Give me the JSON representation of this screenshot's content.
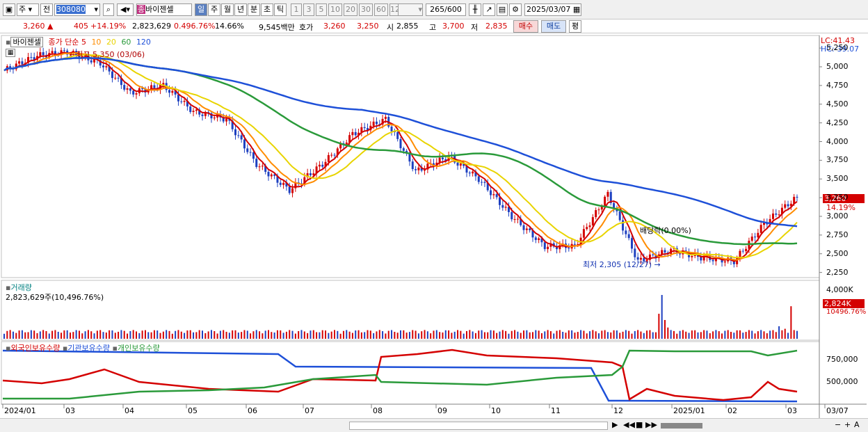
{
  "toolbar": {
    "period_type": "주",
    "prev_label": "전",
    "code": "308080",
    "name": "바이젠셀",
    "name_badge": "종",
    "tabs": [
      "일",
      "주",
      "월",
      "년",
      "분",
      "초",
      "틱"
    ],
    "active_tab": "일",
    "minute_opts": [
      "1",
      "3",
      "5",
      "10",
      "20",
      "30",
      "60",
      "120"
    ],
    "count": "265",
    "count_max": "/600",
    "date": "2025/03/07"
  },
  "quote": {
    "price": "3,260",
    "change": "405",
    "change_pct": "+14.19%",
    "volume": "2,823,629",
    "vol_ratio": "0.496.76%",
    "turnover": "14.66%",
    "amount": "9,545백만",
    "bid_label": "호가",
    "ask": "3,260",
    "bid": "3,250",
    "open_label": "시",
    "open": "2,855",
    "high_label": "고",
    "high": "3,700",
    "low_label": "저",
    "low": "2,835",
    "buy_label": "매수",
    "sell_label": "매도",
    "eval_label": "평"
  },
  "price_panel": {
    "title": "바이젠셀",
    "ma_label": "종가 단순",
    "ma_periods": [
      "5",
      "10",
      "20",
      "60",
      "120"
    ],
    "ma_colors": [
      "#d40000",
      "#ff8c00",
      "#e8d400",
      "#2a9a3a",
      "#1e50d8"
    ],
    "lc": "LC:41.43",
    "hc": "HC:-39.07",
    "high_note": "최고 5,350 (03/06)",
    "low_note": "최저 2,305 (12/27)",
    "div_note": "배당락(0.00%)",
    "price_tag": "3,260",
    "pct_tag": "14.19%",
    "y_ticks": [
      "5,250",
      "5,000",
      "4,750",
      "4,500",
      "4,250",
      "4,000",
      "3,750",
      "3,500",
      "3,250",
      "3,000",
      "2,750",
      "2,500",
      "2,250"
    ]
  },
  "volume_panel": {
    "title": "거래량",
    "value": "2,823,629주(10,496.76%)",
    "y_tick": "4,000K",
    "tag": "2,824K",
    "tag2": "10496.76%"
  },
  "holding_panel": {
    "items": [
      "외국인보유수량",
      "기관보유수량",
      "개인보유수량"
    ],
    "colors": [
      "#d40000",
      "#1e50d8",
      "#2a9a3a"
    ],
    "y_ticks": [
      "750,000",
      "500,000"
    ]
  },
  "x_axis": [
    "2024/01",
    "03",
    "04",
    "05",
    "06",
    "07",
    "08",
    "09",
    "10",
    "11",
    "12",
    "2025/01",
    "02",
    "03",
    "03/07"
  ],
  "chart_data": {
    "type": "candlestick",
    "title": "바이젠셀",
    "ylim": [
      2200,
      5400
    ],
    "close_series": [
      {
        "date": "2024/01",
        "close": 4950
      },
      {
        "date": "2024/02",
        "close": 5150
      },
      {
        "date": "2024/03",
        "close": 5200
      },
      {
        "date": "2024/04",
        "close": 5050
      },
      {
        "date": "2024/05",
        "close": 4650
      },
      {
        "date": "2024/05b",
        "close": 4750
      },
      {
        "date": "2024/06",
        "close": 4400
      },
      {
        "date": "2024/06b",
        "close": 4300
      },
      {
        "date": "2024/07",
        "close": 3700
      },
      {
        "date": "2024/07b",
        "close": 3350
      },
      {
        "date": "2024/08",
        "close": 3700
      },
      {
        "date": "2024/08b",
        "close": 4100
      },
      {
        "date": "2024/09",
        "close": 4300
      },
      {
        "date": "2024/09b",
        "close": 3600
      },
      {
        "date": "2024/10",
        "close": 3800
      },
      {
        "date": "2024/10b",
        "close": 3500
      },
      {
        "date": "2024/11",
        "close": 3000
      },
      {
        "date": "2024/11b",
        "close": 2600
      },
      {
        "date": "2024/12",
        "close": 2600
      },
      {
        "date": "2024/12b",
        "close": 3300
      },
      {
        "date": "2024/12c",
        "close": 2400
      },
      {
        "date": "2025/01",
        "close": 2550
      },
      {
        "date": "2025/02",
        "close": 2450
      },
      {
        "date": "2025/02b",
        "close": 2400
      },
      {
        "date": "2025/03",
        "close": 2900
      },
      {
        "date": "2025/03/07",
        "close": 3260
      }
    ]
  }
}
